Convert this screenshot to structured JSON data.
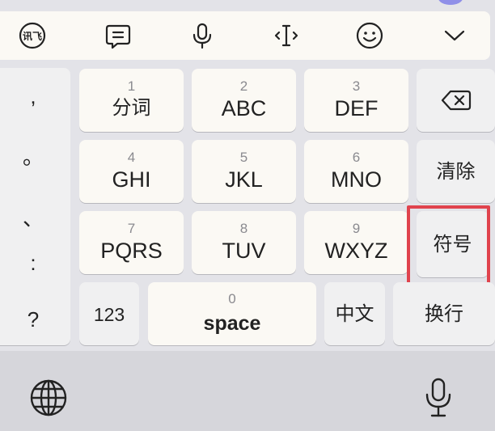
{
  "toolbar": {
    "icons": [
      "xunfei-logo-icon",
      "chat-bubble-icon",
      "microphone-icon",
      "text-cursor-icon",
      "emoji-icon",
      "chevron-down-icon"
    ]
  },
  "punctuation": [
    ",",
    "。",
    "、",
    ":",
    "?"
  ],
  "keys": [
    {
      "num": "1",
      "label": "分词"
    },
    {
      "num": "2",
      "label": "ABC"
    },
    {
      "num": "3",
      "label": "DEF"
    },
    {
      "num": "4",
      "label": "GHI"
    },
    {
      "num": "5",
      "label": "JKL"
    },
    {
      "num": "6",
      "label": "MNO"
    },
    {
      "num": "7",
      "label": "PQRS"
    },
    {
      "num": "8",
      "label": "TUV"
    },
    {
      "num": "9",
      "label": "WXYZ"
    }
  ],
  "right_column": {
    "backspace_icon": "backspace-icon",
    "clear_label": "清除",
    "symbols_label": "符号"
  },
  "bottom_row": {
    "numbers_label": "123",
    "space_num": "0",
    "space_label": "space",
    "chinese_label": "中文",
    "return_label": "换行"
  },
  "system_bar": {
    "globe_icon": "globe-icon",
    "dictation_icon": "microphone-icon"
  },
  "highlight_color": "#e0434d"
}
